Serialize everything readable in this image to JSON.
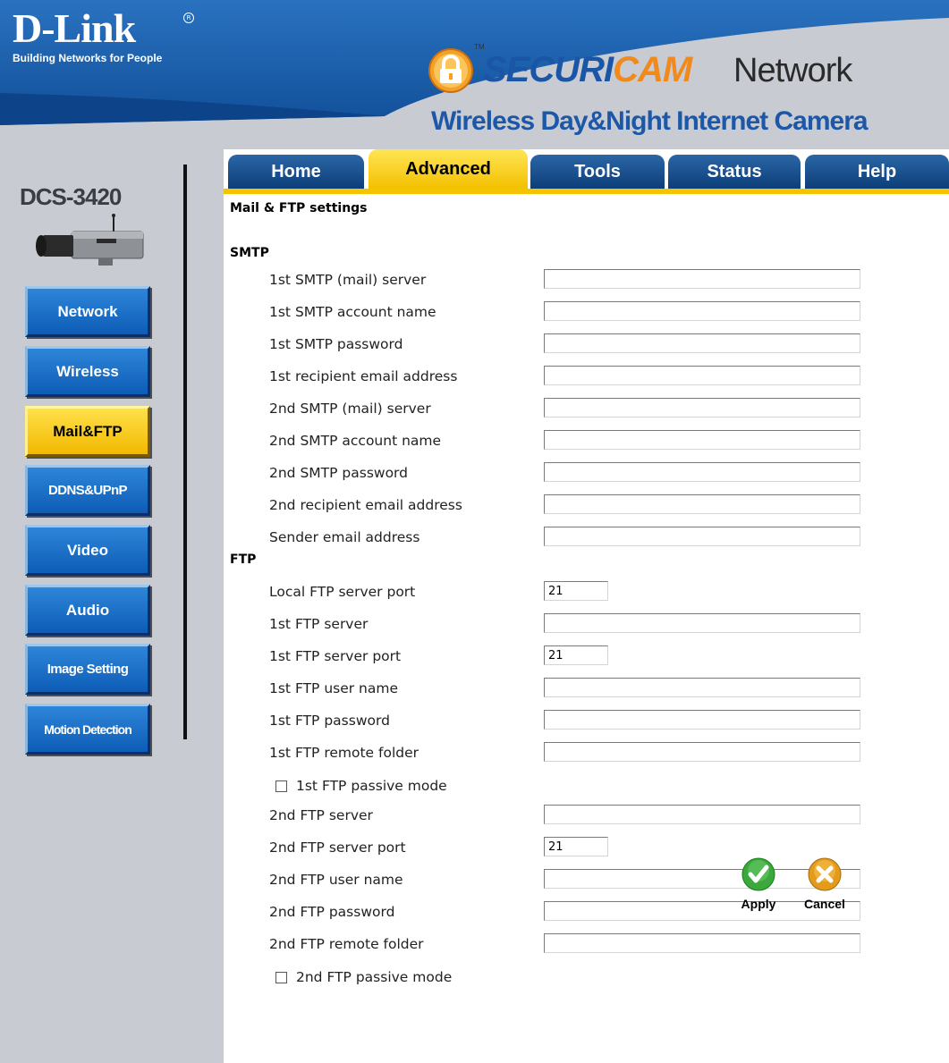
{
  "brand": {
    "logo_text": "D-Link",
    "tagline": "Building Networks for People",
    "securicam_part1": "SECURI",
    "securicam_part2": "CAM",
    "network_word": "Network",
    "product_line": "Wireless Day&Night Internet Camera",
    "model": "DCS-3420"
  },
  "tabs": [
    {
      "label": "Home",
      "active": false
    },
    {
      "label": "Advanced",
      "active": true
    },
    {
      "label": "Tools",
      "active": false
    },
    {
      "label": "Status",
      "active": false
    },
    {
      "label": "Help",
      "active": false
    }
  ],
  "sidebar": {
    "items": [
      {
        "label": "Network",
        "active": false
      },
      {
        "label": "Wireless",
        "active": false
      },
      {
        "label": "Mail&FTP",
        "active": true
      },
      {
        "label": "DDNS&UPnP",
        "active": false
      },
      {
        "label": "Video",
        "active": false
      },
      {
        "label": "Audio",
        "active": false
      },
      {
        "label": "Image Setting",
        "active": false
      },
      {
        "label": "Motion Detection",
        "active": false
      }
    ]
  },
  "page": {
    "title": "Mail & FTP settings",
    "smtp_heading": "SMTP",
    "ftp_heading": "FTP"
  },
  "smtp_fields": [
    {
      "label": "1st SMTP (mail) server",
      "value": ""
    },
    {
      "label": "1st SMTP account name",
      "value": ""
    },
    {
      "label": "1st SMTP password",
      "value": ""
    },
    {
      "label": "1st recipient email address",
      "value": ""
    },
    {
      "label": "2nd SMTP (mail) server",
      "value": ""
    },
    {
      "label": "2nd SMTP account name",
      "value": ""
    },
    {
      "label": "2nd SMTP password",
      "value": ""
    },
    {
      "label": "2nd recipient email address",
      "value": ""
    },
    {
      "label": "Sender email address",
      "value": ""
    }
  ],
  "ftp_fields": {
    "local_port": {
      "label": "Local FTP server port",
      "value": "21"
    },
    "ftp1_server": {
      "label": "1st FTP server",
      "value": ""
    },
    "ftp1_port": {
      "label": "1st FTP server port",
      "value": "21"
    },
    "ftp1_user": {
      "label": "1st FTP user name",
      "value": ""
    },
    "ftp1_password": {
      "label": "1st FTP password",
      "value": ""
    },
    "ftp1_folder": {
      "label": "1st FTP remote folder",
      "value": ""
    },
    "ftp1_passive": {
      "label": "1st FTP passive mode",
      "checked": false
    },
    "ftp2_server": {
      "label": "2nd FTP server",
      "value": ""
    },
    "ftp2_port": {
      "label": "2nd FTP server port",
      "value": "21"
    },
    "ftp2_user": {
      "label": "2nd FTP user name",
      "value": ""
    },
    "ftp2_password": {
      "label": "2nd FTP password",
      "value": ""
    },
    "ftp2_folder": {
      "label": "2nd FTP remote folder",
      "value": ""
    },
    "ftp2_passive": {
      "label": "2nd FTP passive mode",
      "checked": false
    }
  },
  "actions": {
    "apply_label": "Apply",
    "cancel_label": "Cancel"
  },
  "colors": {
    "tab_blue": "#0c3e78",
    "accent_yellow": "#f5c400",
    "sidebar_blue": "#0d5cb6",
    "sidebar_gray": "#c8ccd2",
    "apply_green": "#3aa83a",
    "cancel_orange": "#e59b1a"
  }
}
